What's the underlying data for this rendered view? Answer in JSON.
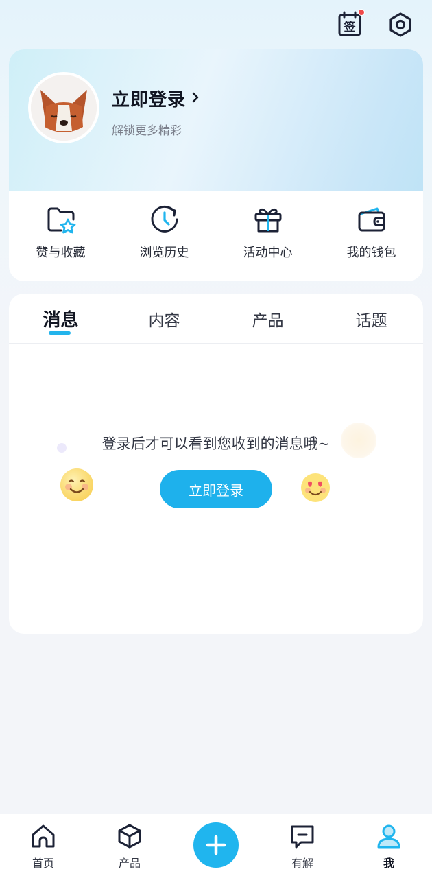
{
  "topbar": {
    "sign_icon_glyph": "签",
    "notification_dot": true
  },
  "profile": {
    "login_title": "立即登录",
    "login_subtitle": "解锁更多精彩"
  },
  "quick_actions": [
    {
      "label": "赞与收藏",
      "icon": "folder-star-icon"
    },
    {
      "label": "浏览历史",
      "icon": "history-clock-icon"
    },
    {
      "label": "活动中心",
      "icon": "gift-icon"
    },
    {
      "label": "我的钱包",
      "icon": "wallet-icon"
    }
  ],
  "tabs": [
    {
      "label": "消息",
      "active": true
    },
    {
      "label": "内容",
      "active": false
    },
    {
      "label": "产品",
      "active": false
    },
    {
      "label": "话题",
      "active": false
    }
  ],
  "empty_state": {
    "message": "登录后才可以看到您收到的消息哦~",
    "button_label": "立即登录"
  },
  "bottom_nav": [
    {
      "label": "首页",
      "icon": "home-icon"
    },
    {
      "label": "产品",
      "icon": "cube-icon"
    },
    {
      "label": "",
      "icon": "plus-icon"
    },
    {
      "label": "有解",
      "icon": "chat-icon"
    },
    {
      "label": "我",
      "icon": "user-icon",
      "active": true
    }
  ],
  "colors": {
    "accent": "#1eb1ec",
    "badge": "#f04a4a"
  }
}
